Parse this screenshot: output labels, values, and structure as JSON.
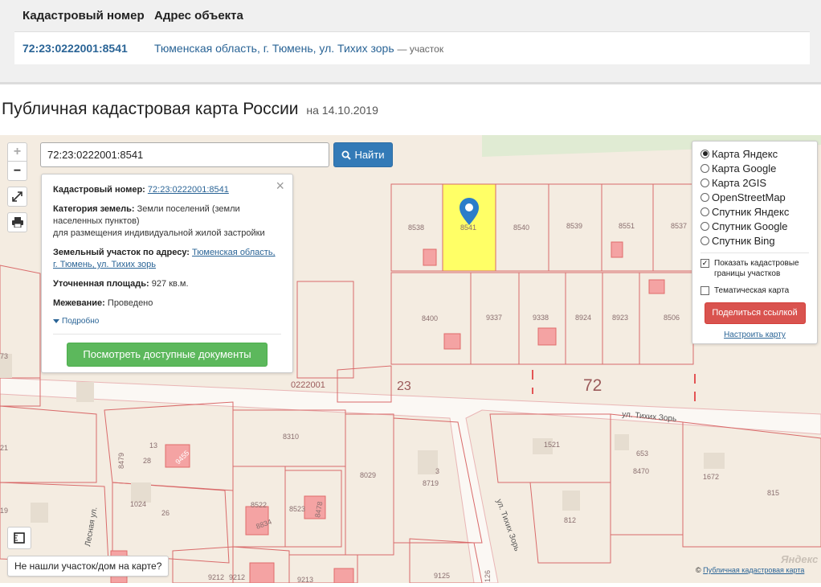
{
  "results_table": {
    "col_cadastral": "Кадастровый номер",
    "col_address": "Адрес объекта",
    "row": {
      "cadastral": "72:23:0222001:8541",
      "address": "Тюменская область, г. Тюмень, ул. Тихих зорь",
      "suffix": "— участок"
    }
  },
  "page": {
    "title": "Публичная кадастровая карта России",
    "date": "на 14.10.2019"
  },
  "map": {
    "search": {
      "value": "72:23:0222001:8541",
      "button": "Найти"
    },
    "zoom": {
      "plus": "+",
      "minus": "−"
    },
    "info_card": {
      "cadastral_label": "Кадастровый номер:",
      "cadastral_value": "72:23:0222001:8541",
      "category_label": "Категория земель:",
      "category_value": "Земли поселений (земли населенных пунктов)",
      "use_value": "для размещения индивидуальной жилой застройки",
      "address_label": "Земельный участок по адресу:",
      "address_value": "Тюменская область, г. Тюмень, ул. Тихих зорь",
      "area_label": "Уточненная площадь:",
      "area_value": "927 кв.м.",
      "survey_label": "Межевание:",
      "survey_value": "Проведено",
      "more": "Подробно",
      "docs_button": "Посмотреть доступные документы"
    },
    "layers": {
      "options": [
        {
          "label": "Карта Яндекс",
          "selected": true
        },
        {
          "label": "Карта Google",
          "selected": false
        },
        {
          "label": "Карта 2GIS",
          "selected": false
        },
        {
          "label": "OpenStreetMap",
          "selected": false
        },
        {
          "label": "Спутник Яндекс",
          "selected": false
        },
        {
          "label": "Спутник Google",
          "selected": false
        },
        {
          "label": "Спутник Bing",
          "selected": false
        }
      ],
      "show_borders": "Показать кадастровые границы участков",
      "show_borders_checked": true,
      "thematic": "Тематическая карта",
      "thematic_checked": false,
      "share_button": "Поделиться ссылкой",
      "configure": "Настроить карту"
    },
    "not_found": "Не нашли участок/дом на карте?",
    "copyright_symbol": "©",
    "copyright_link": "Публичная кадастровая карта",
    "yandex_logo": "Яндекс",
    "labels": {
      "parcels_top": [
        "8538",
        "8541",
        "8540",
        "8539",
        "8551",
        "8537"
      ],
      "parcels_mid": [
        "8400",
        "9337",
        "9338",
        "8924",
        "8923",
        "8506"
      ],
      "quarter": "0222001",
      "district": "23",
      "region": "72",
      "street1": "ул. Тихих Зорь",
      "street2": "ул. Тихих Зорь",
      "street3": "Лесная ул.",
      "misc": [
        "8310",
        "8029",
        "3",
        "8719",
        "1521",
        "653",
        "8470",
        "1672",
        "815",
        "812",
        "13",
        "28",
        "8479",
        "9455",
        "26",
        "1024",
        "8522",
        "8834",
        "8523",
        "8478",
        "9212",
        "9212",
        "9213",
        "9125",
        "126",
        "21",
        "19",
        "73"
      ]
    }
  }
}
